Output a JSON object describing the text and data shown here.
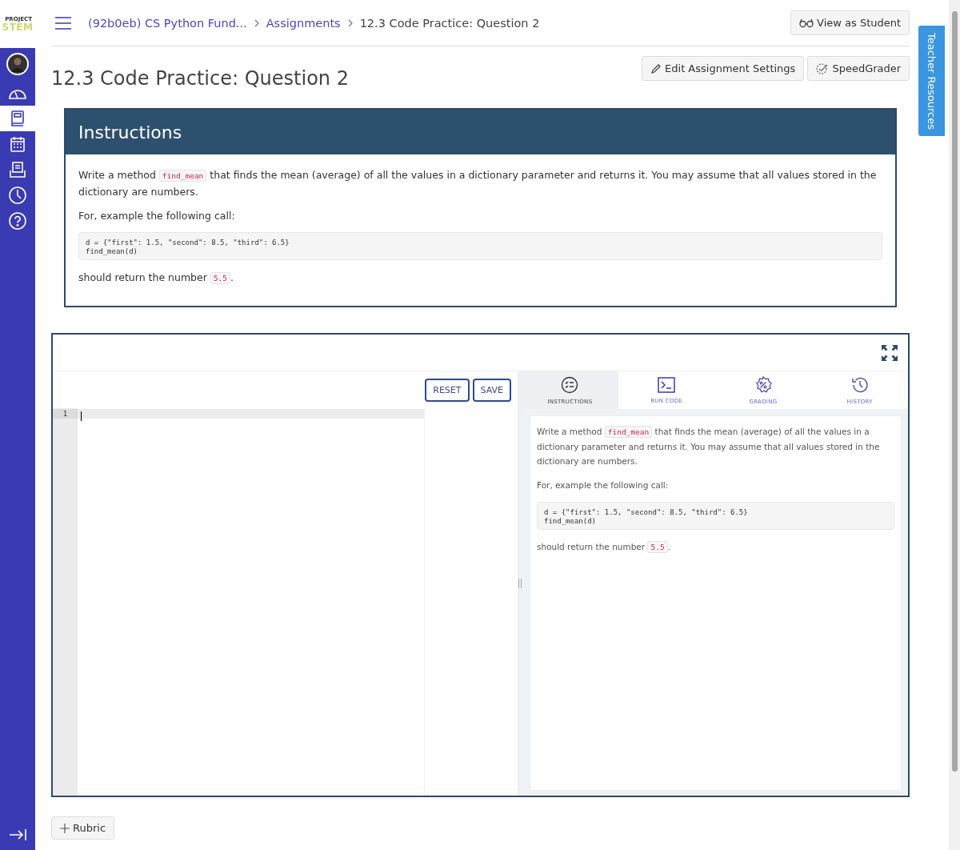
{
  "logo": {
    "small": "PROJECT",
    "main": "STEM"
  },
  "sidebar": {
    "items": [
      {
        "kind": "avatar",
        "selected": false
      },
      {
        "kind": "dashboard",
        "selected": false
      },
      {
        "kind": "courses",
        "selected": true
      },
      {
        "kind": "calendar",
        "selected": false
      },
      {
        "kind": "inbox",
        "selected": false
      },
      {
        "kind": "history",
        "selected": false
      },
      {
        "kind": "help",
        "selected": false
      }
    ]
  },
  "breadcrumbs": [
    {
      "text": "(92b0eb) CS Python Fund...",
      "link": true
    },
    {
      "text": "Assignments",
      "link": true
    },
    {
      "text": "12.3 Code Practice: Question 2",
      "link": false
    }
  ],
  "view_as_student": "View as Student",
  "page_title": "12.3 Code Practice: Question 2",
  "header_buttons": [
    {
      "kind": "edit",
      "label": "Edit Assignment Settings"
    },
    {
      "kind": "grader",
      "label": "SpeedGrader"
    }
  ],
  "instructions": {
    "heading": "Instructions",
    "paragraph": [
      {
        "kind": "text",
        "text": "Write a method "
      },
      {
        "kind": "code",
        "text": "find_mean"
      },
      {
        "kind": "text",
        "text": " that finds the mean (average) of all the values in a dictionary parameter and returns it. You may assume that all values stored in the dictionary are numbers."
      }
    ],
    "example": "For, example the following call:",
    "code_lines": [
      "d = {\"first\": 1.5, \"second\": 8.5, \"third\": 6.5}",
      "find_mean(d)"
    ],
    "result": [
      {
        "kind": "text",
        "text": "should return the number "
      },
      {
        "kind": "code",
        "text": "5.5"
      },
      {
        "kind": "text",
        "text": "."
      }
    ]
  },
  "editor": {
    "buttons": [
      "RESET",
      "SAVE"
    ],
    "line_numbers": [
      "1"
    ],
    "tabs": [
      {
        "kind": "instructions",
        "label": "INSTRUCTIONS",
        "selected": true
      },
      {
        "kind": "run",
        "label": "RUN CODE",
        "selected": false
      },
      {
        "kind": "grading",
        "label": "GRADING",
        "selected": false
      },
      {
        "kind": "history",
        "label": "HISTORY",
        "selected": false
      }
    ],
    "panel": {
      "paragraph": [
        {
          "kind": "text",
          "text": "Write a method "
        },
        {
          "kind": "code",
          "text": "find_mean"
        },
        {
          "kind": "text",
          "text": " that finds the mean (average) of all the values in a dictionary parameter and returns it. You may assume that all values stored in the dictionary are numbers."
        }
      ],
      "example": "For, example the following call:",
      "code_lines": [
        "d = {\"first\": 1.5, \"second\": 8.5, \"third\": 6.5}",
        "find_mean(d)"
      ],
      "result": [
        {
          "kind": "text",
          "text": "should return the number "
        },
        {
          "kind": "code",
          "text": "5.5"
        },
        {
          "kind": "text",
          "text": "."
        }
      ]
    }
  },
  "rubric_button": "Rubric",
  "teacher_resources": "Teacher Resources"
}
